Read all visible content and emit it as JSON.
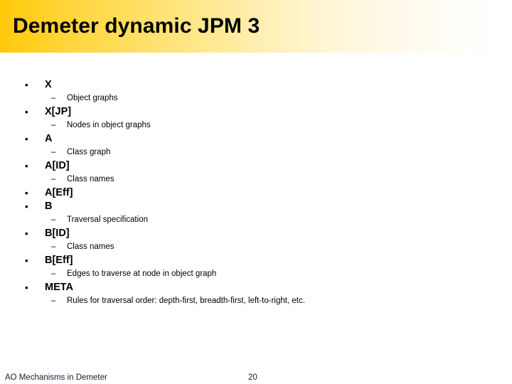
{
  "slide": {
    "title": "Demeter dynamic JPM 3",
    "accent_color": "#ffc90b",
    "background_color": "#ffffff",
    "text_color": "#000000",
    "bullet_glyph": "•",
    "dash_glyph": "–",
    "items": [
      {
        "label": "X",
        "sub": "Object graphs"
      },
      {
        "label": "X[JP]",
        "sub": "Nodes in object graphs"
      },
      {
        "label": "A",
        "sub": "Class graph"
      },
      {
        "label": "A[ID]",
        "sub": "Class names"
      },
      {
        "label": "A[Eff]",
        "sub": null
      },
      {
        "label": "B",
        "sub": "Traversal specification"
      },
      {
        "label": "B[ID]",
        "sub": "Class names"
      },
      {
        "label": "B[Eff]",
        "sub": "Edges to traverse at node in object graph"
      },
      {
        "label": "META",
        "sub": "Rules for traversal order: depth-first, breadth-first, left-to-right, etc."
      }
    ]
  },
  "footer": {
    "left_text": "AO Mechanisms in Demeter",
    "page_number": "20"
  }
}
